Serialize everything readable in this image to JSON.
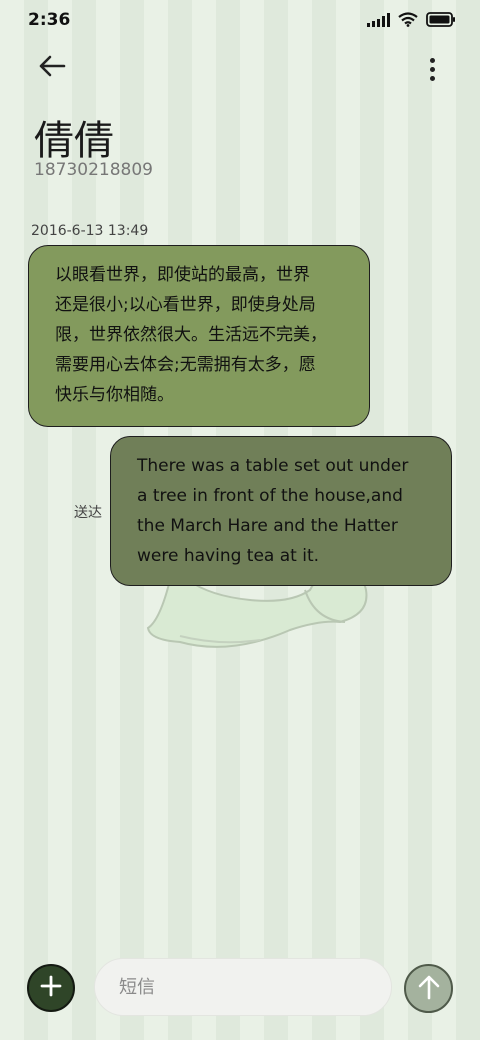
{
  "status_bar": {
    "time": "2:36",
    "icons": [
      "signal-icon",
      "wifi-icon",
      "battery-icon"
    ]
  },
  "header": {
    "back_icon": "back-arrow-icon",
    "menu_icon": "more-vertical-icon"
  },
  "contact": {
    "name": "倩倩",
    "number": "18730218809"
  },
  "conversation": {
    "timestamp": "2016-6-13 13:49",
    "received": {
      "lines": [
        "以眼看世界，即使站的最高，世界",
        "还是很小;以心看世界，即使身处局",
        "限，世界依然很大。生活远不完美，",
        "需要用心去体会;无需拥有太多，愿",
        "快乐与你相随。"
      ]
    },
    "sent": {
      "lines": [
        "There was a table set out under",
        "a tree in front of the house,and",
        "the March Hare and the Hatter",
        "were having tea at it."
      ],
      "status": "送达"
    }
  },
  "compose": {
    "add_icon": "plus-icon",
    "placeholder": "短信",
    "value": "",
    "send_icon": "arrow-up-icon"
  },
  "colors": {
    "received_bubble": "#839a5d",
    "sent_bubble": "#707f58",
    "add_button": "#2f4528",
    "send_button": "#a4b29e"
  }
}
